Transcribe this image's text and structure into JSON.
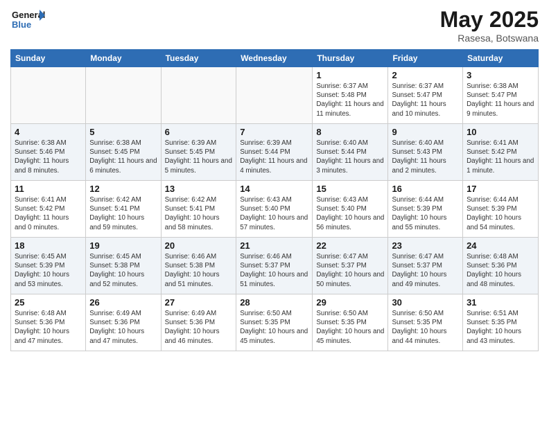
{
  "logo": {
    "text_general": "General",
    "text_blue": "Blue"
  },
  "header": {
    "month_year": "May 2025",
    "location": "Rasesa, Botswana"
  },
  "days_of_week": [
    "Sunday",
    "Monday",
    "Tuesday",
    "Wednesday",
    "Thursday",
    "Friday",
    "Saturday"
  ],
  "weeks": [
    [
      {
        "day": "",
        "info": ""
      },
      {
        "day": "",
        "info": ""
      },
      {
        "day": "",
        "info": ""
      },
      {
        "day": "",
        "info": ""
      },
      {
        "day": "1",
        "info": "Sunrise: 6:37 AM\nSunset: 5:48 PM\nDaylight: 11 hours and 11 minutes."
      },
      {
        "day": "2",
        "info": "Sunrise: 6:37 AM\nSunset: 5:47 PM\nDaylight: 11 hours and 10 minutes."
      },
      {
        "day": "3",
        "info": "Sunrise: 6:38 AM\nSunset: 5:47 PM\nDaylight: 11 hours and 9 minutes."
      }
    ],
    [
      {
        "day": "4",
        "info": "Sunrise: 6:38 AM\nSunset: 5:46 PM\nDaylight: 11 hours and 8 minutes."
      },
      {
        "day": "5",
        "info": "Sunrise: 6:38 AM\nSunset: 5:45 PM\nDaylight: 11 hours and 6 minutes."
      },
      {
        "day": "6",
        "info": "Sunrise: 6:39 AM\nSunset: 5:45 PM\nDaylight: 11 hours and 5 minutes."
      },
      {
        "day": "7",
        "info": "Sunrise: 6:39 AM\nSunset: 5:44 PM\nDaylight: 11 hours and 4 minutes."
      },
      {
        "day": "8",
        "info": "Sunrise: 6:40 AM\nSunset: 5:44 PM\nDaylight: 11 hours and 3 minutes."
      },
      {
        "day": "9",
        "info": "Sunrise: 6:40 AM\nSunset: 5:43 PM\nDaylight: 11 hours and 2 minutes."
      },
      {
        "day": "10",
        "info": "Sunrise: 6:41 AM\nSunset: 5:42 PM\nDaylight: 11 hours and 1 minute."
      }
    ],
    [
      {
        "day": "11",
        "info": "Sunrise: 6:41 AM\nSunset: 5:42 PM\nDaylight: 11 hours and 0 minutes."
      },
      {
        "day": "12",
        "info": "Sunrise: 6:42 AM\nSunset: 5:41 PM\nDaylight: 10 hours and 59 minutes."
      },
      {
        "day": "13",
        "info": "Sunrise: 6:42 AM\nSunset: 5:41 PM\nDaylight: 10 hours and 58 minutes."
      },
      {
        "day": "14",
        "info": "Sunrise: 6:43 AM\nSunset: 5:40 PM\nDaylight: 10 hours and 57 minutes."
      },
      {
        "day": "15",
        "info": "Sunrise: 6:43 AM\nSunset: 5:40 PM\nDaylight: 10 hours and 56 minutes."
      },
      {
        "day": "16",
        "info": "Sunrise: 6:44 AM\nSunset: 5:39 PM\nDaylight: 10 hours and 55 minutes."
      },
      {
        "day": "17",
        "info": "Sunrise: 6:44 AM\nSunset: 5:39 PM\nDaylight: 10 hours and 54 minutes."
      }
    ],
    [
      {
        "day": "18",
        "info": "Sunrise: 6:45 AM\nSunset: 5:39 PM\nDaylight: 10 hours and 53 minutes."
      },
      {
        "day": "19",
        "info": "Sunrise: 6:45 AM\nSunset: 5:38 PM\nDaylight: 10 hours and 52 minutes."
      },
      {
        "day": "20",
        "info": "Sunrise: 6:46 AM\nSunset: 5:38 PM\nDaylight: 10 hours and 51 minutes."
      },
      {
        "day": "21",
        "info": "Sunrise: 6:46 AM\nSunset: 5:37 PM\nDaylight: 10 hours and 51 minutes."
      },
      {
        "day": "22",
        "info": "Sunrise: 6:47 AM\nSunset: 5:37 PM\nDaylight: 10 hours and 50 minutes."
      },
      {
        "day": "23",
        "info": "Sunrise: 6:47 AM\nSunset: 5:37 PM\nDaylight: 10 hours and 49 minutes."
      },
      {
        "day": "24",
        "info": "Sunrise: 6:48 AM\nSunset: 5:36 PM\nDaylight: 10 hours and 48 minutes."
      }
    ],
    [
      {
        "day": "25",
        "info": "Sunrise: 6:48 AM\nSunset: 5:36 PM\nDaylight: 10 hours and 47 minutes."
      },
      {
        "day": "26",
        "info": "Sunrise: 6:49 AM\nSunset: 5:36 PM\nDaylight: 10 hours and 47 minutes."
      },
      {
        "day": "27",
        "info": "Sunrise: 6:49 AM\nSunset: 5:36 PM\nDaylight: 10 hours and 46 minutes."
      },
      {
        "day": "28",
        "info": "Sunrise: 6:50 AM\nSunset: 5:35 PM\nDaylight: 10 hours and 45 minutes."
      },
      {
        "day": "29",
        "info": "Sunrise: 6:50 AM\nSunset: 5:35 PM\nDaylight: 10 hours and 45 minutes."
      },
      {
        "day": "30",
        "info": "Sunrise: 6:50 AM\nSunset: 5:35 PM\nDaylight: 10 hours and 44 minutes."
      },
      {
        "day": "31",
        "info": "Sunrise: 6:51 AM\nSunset: 5:35 PM\nDaylight: 10 hours and 43 minutes."
      }
    ]
  ]
}
